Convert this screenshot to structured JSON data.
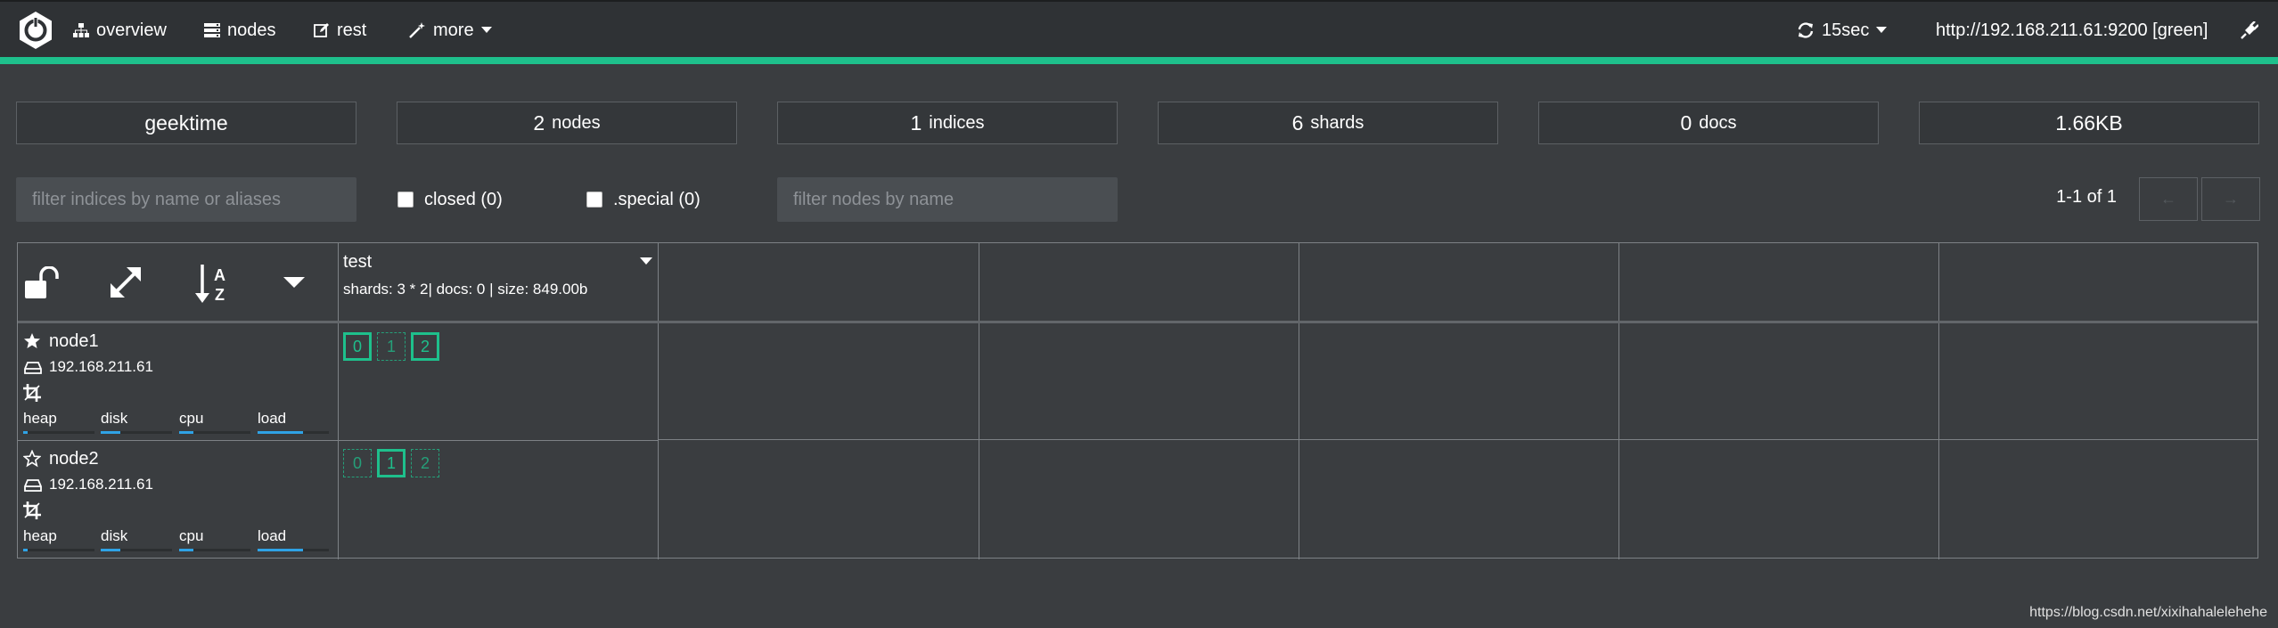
{
  "nav": {
    "overview": "overview",
    "nodes": "nodes",
    "rest": "rest",
    "more": "more",
    "refresh": "15sec",
    "cluster_url": "http://192.168.211.61:9200 [green]"
  },
  "summary": {
    "cluster_name": "geektime",
    "nodes_num": "2",
    "nodes_unit": "nodes",
    "indices_num": "1",
    "indices_unit": "indices",
    "shards_num": "6",
    "shards_unit": "shards",
    "docs_num": "0",
    "docs_unit": "docs",
    "size": "1.66KB"
  },
  "filters": {
    "indices_placeholder": "filter indices by name or aliases",
    "closed_label": "closed (0)",
    "special_label": ".special (0)",
    "nodes_placeholder": "filter nodes by name",
    "pager_text": "1-1 of 1",
    "prev_label": "←",
    "next_label": "→"
  },
  "index": {
    "name": "test",
    "info": "shards: 3 * 2| docs: 0 | size: 849.00b"
  },
  "nodes": [
    {
      "name": "node1",
      "master": true,
      "ip": "192.168.211.61",
      "metrics": {
        "heap": "heap",
        "disk": "disk",
        "cpu": "cpu",
        "load": "load"
      },
      "levels": {
        "heap": 0.06,
        "disk": 0.28,
        "cpu": 0.2,
        "load": 0.64
      },
      "shards": [
        {
          "id": "0",
          "primary": true
        },
        {
          "id": "1",
          "primary": false
        },
        {
          "id": "2",
          "primary": true
        }
      ]
    },
    {
      "name": "node2",
      "master": false,
      "ip": "192.168.211.61",
      "metrics": {
        "heap": "heap",
        "disk": "disk",
        "cpu": "cpu",
        "load": "load"
      },
      "levels": {
        "heap": 0.06,
        "disk": 0.28,
        "cpu": 0.2,
        "load": 0.64
      },
      "shards": [
        {
          "id": "0",
          "primary": false
        },
        {
          "id": "1",
          "primary": true
        },
        {
          "id": "2",
          "primary": false
        }
      ]
    }
  ],
  "watermark": "https://blog.csdn.net/xixihahalelehehe",
  "colors": {
    "accent": "#1ec08c",
    "metric_bar": "#2fa3e6",
    "background": "#3a3d40",
    "topbar": "#2f3235"
  }
}
